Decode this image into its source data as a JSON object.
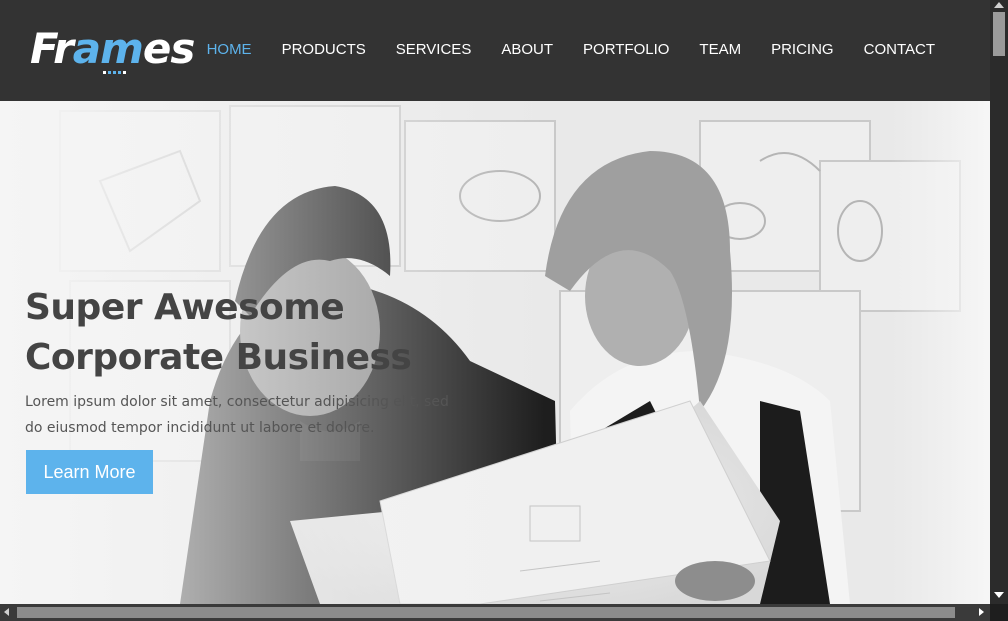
{
  "logo": {
    "text_main": "Fr",
    "text_accent": "am",
    "text_end": "es"
  },
  "nav": {
    "items": [
      {
        "label": "HOME",
        "active": true
      },
      {
        "label": "PRODUCTS"
      },
      {
        "label": "SERVICES"
      },
      {
        "label": "ABOUT"
      },
      {
        "label": "PORTFOLIO"
      },
      {
        "label": "TEAM"
      },
      {
        "label": "PRICING"
      },
      {
        "label": "CONTACT"
      }
    ]
  },
  "hero": {
    "title_line1": "Super Awesome",
    "title_line2": "Corporate Business",
    "text": "Lorem ipsum dolor sit amet, consectetur adipisicing elit, sed do eiusmod tempor incididunt ut labore et dolore.",
    "button_label": "Learn More"
  },
  "colors": {
    "accent": "#5db3ec",
    "header_bg": "#333333",
    "title": "#444444"
  },
  "icons": [
    "logo-dots-icon",
    "scroll-up-icon",
    "scroll-down-icon",
    "scroll-left-icon",
    "scroll-right-icon"
  ]
}
